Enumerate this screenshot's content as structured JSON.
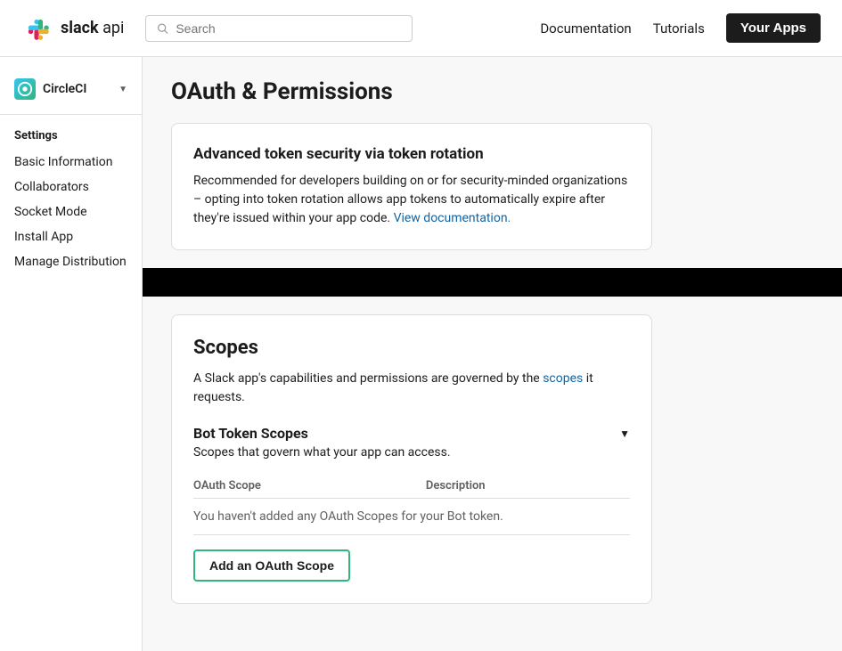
{
  "header": {
    "logo_text": "slack",
    "api_text": "api",
    "search_placeholder": "Search",
    "nav": {
      "documentation": "Documentation",
      "tutorials": "Tutorials",
      "your_apps": "Your Apps"
    }
  },
  "sidebar": {
    "app_name": "CircleCI",
    "section_title": "Settings",
    "items": [
      {
        "label": "Basic Information",
        "active": false
      },
      {
        "label": "Collaborators",
        "active": false
      },
      {
        "label": "Socket Mode",
        "active": false
      },
      {
        "label": "Install App",
        "active": false
      },
      {
        "label": "Manage Distribution",
        "active": false
      }
    ]
  },
  "main": {
    "page_title": "OAuth & Permissions",
    "token_rotation": {
      "title": "Advanced token security via token rotation",
      "description": "Recommended for developers building on or for security-minded organizations – opting into token rotation allows app tokens to automatically expire after they're issued within your app code.",
      "link_text": "View documentation.",
      "link_href": "#"
    },
    "scopes": {
      "title": "Scopes",
      "description_text": "A Slack app's capabilities and permissions are governed by the",
      "scopes_link_text": "scopes",
      "description_rest": " it requests.",
      "bot_token": {
        "title": "Bot Token Scopes",
        "description": "Scopes that govern what your app can access.",
        "table_headers": [
          "OAuth Scope",
          "Description"
        ],
        "empty_message": "You haven't added any OAuth Scopes for your Bot token.",
        "add_button_label": "Add an OAuth Scope"
      }
    }
  }
}
